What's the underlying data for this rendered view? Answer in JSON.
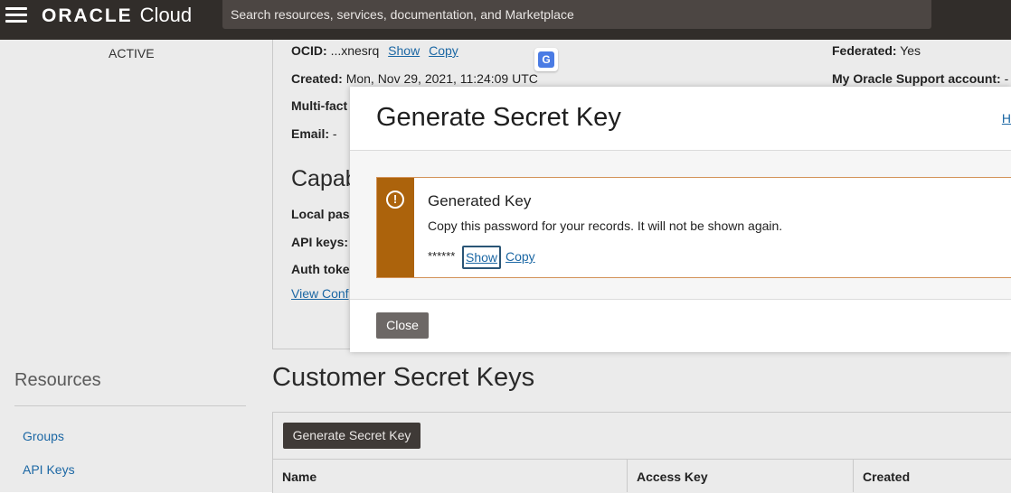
{
  "topbar": {
    "logo_brand": "ORACLE",
    "logo_product": "Cloud",
    "search_placeholder": "Search resources, services, documentation, and Marketplace"
  },
  "sidebar": {
    "status": "ACTIVE",
    "resources_title": "Resources",
    "links": [
      "Groups",
      "API Keys"
    ]
  },
  "details": {
    "ocid_label": "OCID:",
    "ocid_value": "...xnesrq",
    "ocid_show": "Show",
    "ocid_copy": "Copy",
    "created_label": "Created:",
    "created_value": "Mon, Nov 29, 2021, 11:24:09 UTC",
    "mfa_label": "Multi-fact",
    "email_label": "Email:",
    "email_value": "-",
    "federated_label": "Federated:",
    "federated_value": "Yes",
    "support_label": "My Oracle Support account:",
    "support_value": "-",
    "capabilities_heading": "Capab",
    "local_pass_label": "Local pas",
    "api_keys_label": "API keys:",
    "auth_tokens_label": "Auth toke",
    "view_config_link": "View Conf"
  },
  "modal": {
    "title": "Generate Secret Key",
    "help_link": "H",
    "alert_title": "Generated Key",
    "alert_message": "Copy this password for your records. It will not be shown again.",
    "masked_password": "******",
    "show_label": "Show",
    "copy_label": "Copy",
    "close_label": "Close",
    "alert_color": "#ac630c"
  },
  "customer_keys": {
    "title": "Customer Secret Keys",
    "generate_button": "Generate Secret Key",
    "columns": [
      "Name",
      "Access Key",
      "Created"
    ]
  }
}
